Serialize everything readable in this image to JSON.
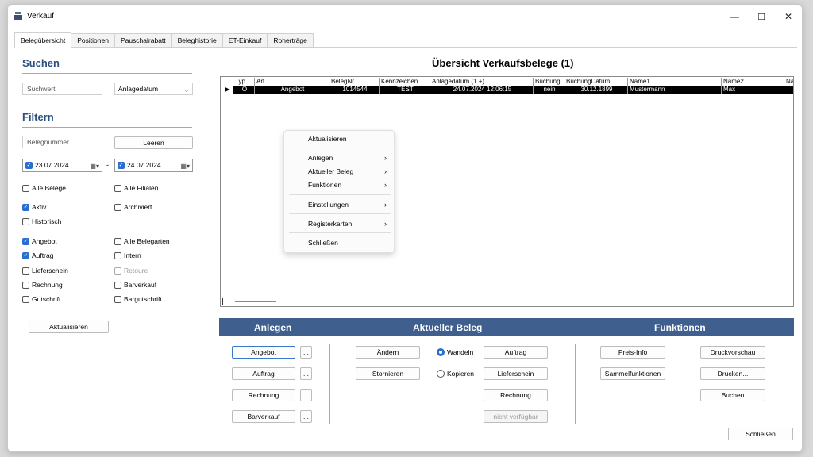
{
  "window": {
    "title": "Verkauf",
    "controls": [
      "—",
      "☐",
      "✕"
    ]
  },
  "tabs": [
    "Belegübersicht",
    "Positionen",
    "Pauschalrabatt",
    "Beleghistorie",
    "ET-Einkauf",
    "Roherträge"
  ],
  "left": {
    "search_head": "Suchen",
    "search_placeholder": "Suchwert",
    "search_select": "Anlagedatum",
    "filter_head": "Filtern",
    "belegnr_placeholder": "Belegnummer",
    "clear_btn": "Leeren",
    "date_from": "23.07.2024",
    "date_to": "24.07.2024",
    "dash": "-",
    "checks": {
      "alle_belege": "Alle Belege",
      "alle_filialen": "Alle Filialen",
      "aktiv": "Aktiv",
      "archiviert": "Archiviert",
      "historisch": "Historisch",
      "angebot": "Angebot",
      "alle_belegarten": "Alle Belegarten",
      "auftrag": "Auftrag",
      "intern": "Intern",
      "lieferschein": "Lieferschein",
      "retoure": "Retoure",
      "rechnung": "Rechnung",
      "barverkauf": "Barverkauf",
      "gutschrift": "Gutschrift",
      "bargutschrift": "Bargutschrift"
    },
    "refresh_btn": "Aktualisieren"
  },
  "grid": {
    "title": "Übersicht Verkaufsbelege (1)",
    "columns": [
      "Typ",
      "Art",
      "BelegNr",
      "Kennzeichen",
      "Anlagedatum (1 +)",
      "Buchung",
      "BuchungDatum",
      "Name1",
      "Name2",
      "Na"
    ],
    "row": [
      "O",
      "Angebot",
      "1014544",
      "TEST",
      "24.07.2024 12:06:15",
      "nein",
      "30.12.1899",
      "Mustermann",
      "Max",
      ""
    ],
    "row_marker": "▶"
  },
  "context_menu": {
    "aktualisieren": "Aktualisieren",
    "anlegen": "Anlegen",
    "aktueller_beleg": "Aktueller Beleg",
    "funktionen": "Funktionen",
    "einstellungen": "Einstellungen",
    "registerkarten": "Registerkarten",
    "schliessen": "Schließen",
    "arrow": "›"
  },
  "bottom": {
    "head_anlegen": "Anlegen",
    "head_beleg": "Aktueller Beleg",
    "head_funktionen": "Funktionen",
    "anlegen": [
      "Angebot",
      "Auftrag",
      "Rechnung",
      "Barverkauf"
    ],
    "dots": "...",
    "aendern": "Ändern",
    "stornieren": "Stornieren",
    "wandeln": "Wandeln",
    "kopieren": "Kopieren",
    "beleg_targets": [
      "Auftrag",
      "Lieferschein",
      "Rechnung",
      "nicht verfügbar"
    ],
    "preis_info": "Preis-Info",
    "sammelfunktionen": "Sammelfunktionen",
    "druckvorschau": "Druckvorschau",
    "drucken": "Drucken...",
    "buchen": "Buchen",
    "close": "Schließen"
  },
  "colors": {
    "accent": "#e2a23b",
    "header_blue": "#2b4f7e",
    "bar_blue": "#3f5f8f",
    "check_blue": "#2a6fcf"
  }
}
